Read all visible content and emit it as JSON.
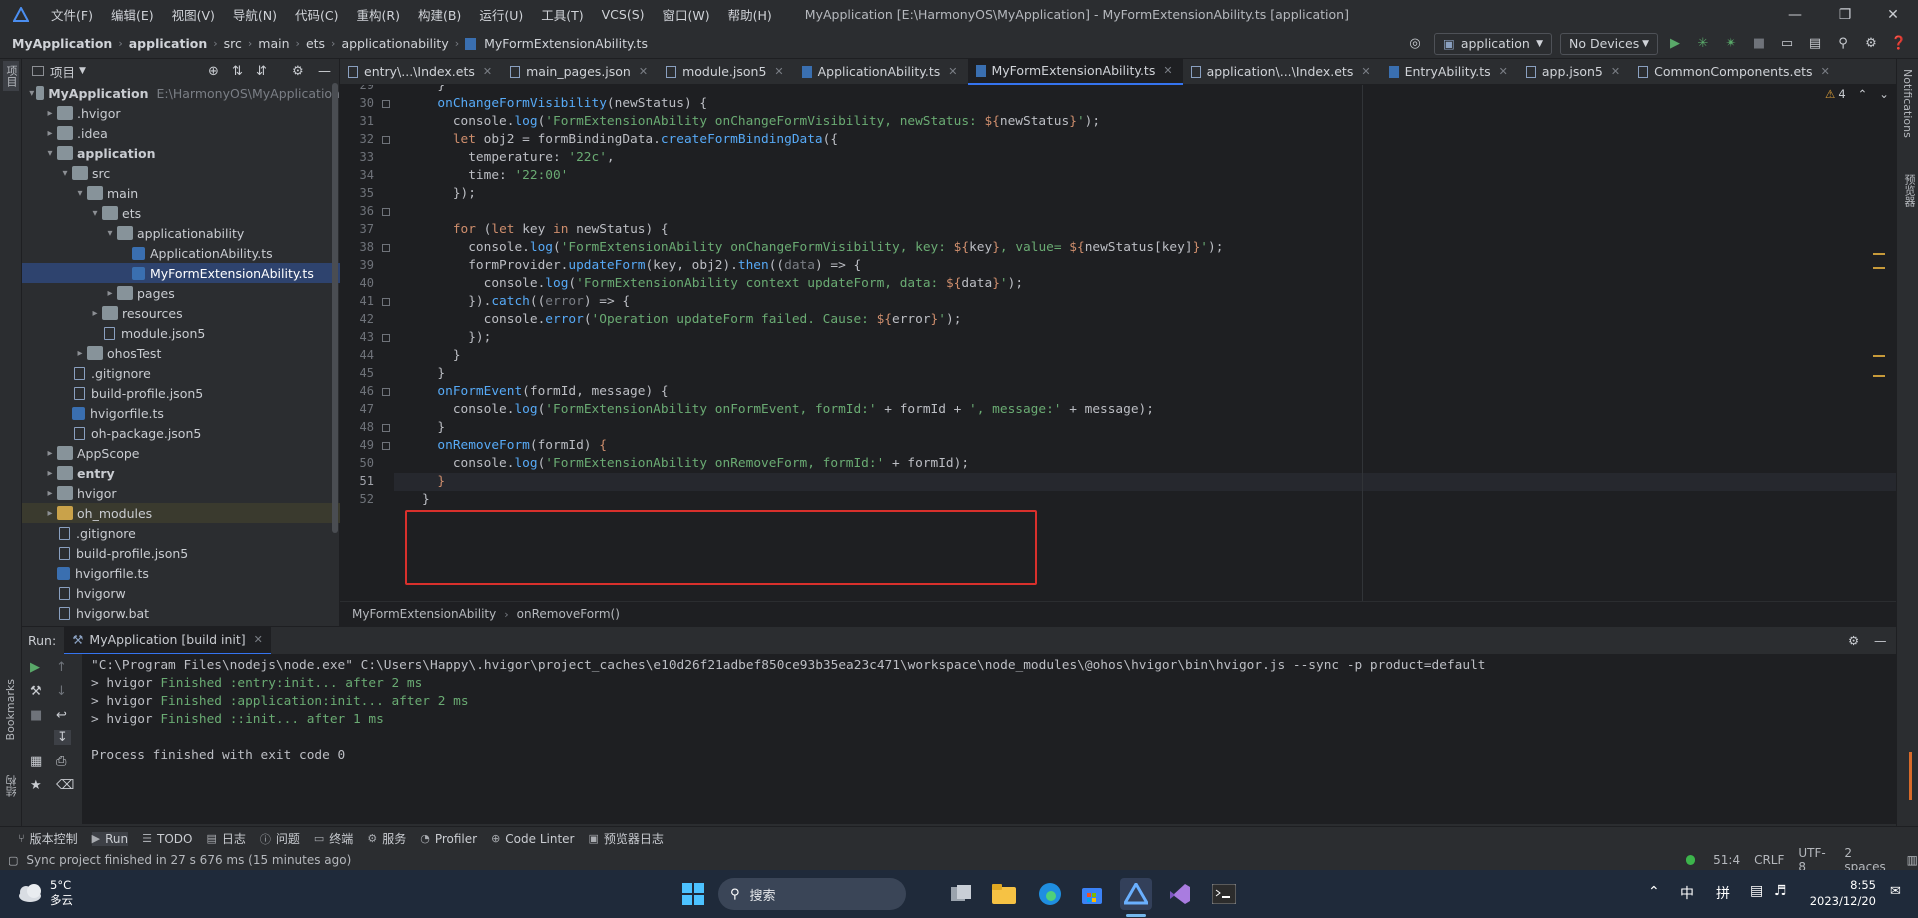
{
  "window": {
    "menus": [
      "文件(F)",
      "编辑(E)",
      "视图(V)",
      "导航(N)",
      "代码(C)",
      "重构(R)",
      "构建(B)",
      "运行(U)",
      "工具(T)",
      "VCS(S)",
      "窗口(W)",
      "帮助(H)"
    ],
    "title": "MyApplication [E:\\HarmonyOS\\MyApplication] - MyFormExtensionAbility.ts [application]"
  },
  "nav": {
    "breadcrumbs": [
      "MyApplication",
      "application",
      "src",
      "main",
      "ets",
      "applicationability",
      "MyFormExtensionAbility.ts"
    ],
    "run_config": "application",
    "device": "No Devices"
  },
  "sidebar": {
    "left_label": "项目",
    "bookmarks": "Bookmarks",
    "structure": "结构",
    "notifications": "Notifications",
    "preview": "预览器"
  },
  "project": {
    "title": "项目",
    "tree": [
      {
        "label": "MyApplication",
        "extra": "E:\\HarmonyOS\\MyApplication",
        "depth": 0,
        "arrow": "open",
        "icon": "folder",
        "bold": true
      },
      {
        "label": ".hvigor",
        "depth": 1,
        "arrow": "closed",
        "icon": "folder"
      },
      {
        "label": ".idea",
        "depth": 1,
        "arrow": "closed",
        "icon": "folder"
      },
      {
        "label": "application",
        "depth": 1,
        "arrow": "open",
        "icon": "folder",
        "bold": true
      },
      {
        "label": "src",
        "depth": 2,
        "arrow": "open",
        "icon": "folder"
      },
      {
        "label": "main",
        "depth": 3,
        "arrow": "open",
        "icon": "folder"
      },
      {
        "label": "ets",
        "depth": 4,
        "arrow": "open",
        "icon": "folder"
      },
      {
        "label": "applicationability",
        "depth": 5,
        "arrow": "open",
        "icon": "folder"
      },
      {
        "label": "ApplicationAbility.ts",
        "depth": 6,
        "arrow": "none",
        "icon": "ts"
      },
      {
        "label": "MyFormExtensionAbility.ts",
        "depth": 6,
        "arrow": "none",
        "icon": "ts",
        "selected": true
      },
      {
        "label": "pages",
        "depth": 5,
        "arrow": "closed",
        "icon": "folder"
      },
      {
        "label": "resources",
        "depth": 4,
        "arrow": "closed",
        "icon": "folder"
      },
      {
        "label": "module.json5",
        "depth": 4,
        "arrow": "none",
        "icon": "file"
      },
      {
        "label": "ohosTest",
        "depth": 3,
        "arrow": "closed",
        "icon": "folder"
      },
      {
        "label": ".gitignore",
        "depth": 2,
        "arrow": "none",
        "icon": "file"
      },
      {
        "label": "build-profile.json5",
        "depth": 2,
        "arrow": "none",
        "icon": "file"
      },
      {
        "label": "hvigorfile.ts",
        "depth": 2,
        "arrow": "none",
        "icon": "ts"
      },
      {
        "label": "oh-package.json5",
        "depth": 2,
        "arrow": "none",
        "icon": "file"
      },
      {
        "label": "AppScope",
        "depth": 1,
        "arrow": "closed",
        "icon": "folder"
      },
      {
        "label": "entry",
        "depth": 1,
        "arrow": "closed",
        "icon": "folder",
        "bold": true
      },
      {
        "label": "hvigor",
        "depth": 1,
        "arrow": "closed",
        "icon": "folder"
      },
      {
        "label": "oh_modules",
        "depth": 1,
        "arrow": "closed",
        "icon": "folder-orange",
        "highlight": true
      },
      {
        "label": ".gitignore",
        "depth": 1,
        "arrow": "none",
        "icon": "file"
      },
      {
        "label": "build-profile.json5",
        "depth": 1,
        "arrow": "none",
        "icon": "file"
      },
      {
        "label": "hvigorfile.ts",
        "depth": 1,
        "arrow": "none",
        "icon": "ts"
      },
      {
        "label": "hvigorw",
        "depth": 1,
        "arrow": "none",
        "icon": "file"
      },
      {
        "label": "hvigorw.bat",
        "depth": 1,
        "arrow": "none",
        "icon": "file"
      }
    ]
  },
  "tabs": [
    {
      "label": "entry\\...\\Index.ets"
    },
    {
      "label": "main_pages.json"
    },
    {
      "label": "module.json5"
    },
    {
      "label": "ApplicationAbility.ts"
    },
    {
      "label": "MyFormExtensionAbility.ts",
      "active": true
    },
    {
      "label": "application\\...\\Index.ets"
    },
    {
      "label": "EntryAbility.ts"
    },
    {
      "label": "app.json5"
    },
    {
      "label": "CommonComponents.ets"
    }
  ],
  "editor": {
    "warnings": "4",
    "lines": [
      {
        "n": "29",
        "t": [
          [
            "vr",
            "  }"
          ]
        ]
      },
      {
        "n": "30",
        "t": [
          [
            "fn",
            "  onChangeFormVisibility"
          ],
          [
            "vr",
            "(newStatus) {"
          ]
        ]
      },
      {
        "n": "31",
        "t": [
          [
            "vr",
            "    console."
          ],
          [
            "fn",
            "log"
          ],
          [
            "vr",
            "("
          ],
          [
            "st",
            "'FormExtensionAbility onChangeFormVisibility, newStatus: "
          ],
          [
            "kw",
            "${"
          ],
          [
            "vr",
            "newStatus"
          ],
          [
            "kw",
            "}"
          ],
          [
            "st",
            "'"
          ],
          [
            "vr",
            ");"
          ]
        ]
      },
      {
        "n": "32",
        "t": [
          [
            "kw",
            "    let "
          ],
          [
            "vr",
            "obj2 = formBindingData."
          ],
          [
            "fn",
            "createFormBindingData"
          ],
          [
            "vr",
            "({"
          ]
        ]
      },
      {
        "n": "33",
        "t": [
          [
            "vr",
            "      temperature: "
          ],
          [
            "st",
            "'22c'"
          ],
          [
            "vr",
            ","
          ]
        ]
      },
      {
        "n": "34",
        "t": [
          [
            "vr",
            "      time: "
          ],
          [
            "st",
            "'22:00'"
          ]
        ]
      },
      {
        "n": "35",
        "t": [
          [
            "vr",
            "    });"
          ]
        ]
      },
      {
        "n": "36",
        "t": [
          [
            "vr",
            ""
          ]
        ]
      },
      {
        "n": "37",
        "t": [
          [
            "kw",
            "    for "
          ],
          [
            "vr",
            "("
          ],
          [
            "kw",
            "let "
          ],
          [
            "vr",
            "key "
          ],
          [
            "kw",
            "in "
          ],
          [
            "vr",
            "newStatus) {"
          ]
        ]
      },
      {
        "n": "38",
        "t": [
          [
            "vr",
            "      console."
          ],
          [
            "fn",
            "log"
          ],
          [
            "vr",
            "("
          ],
          [
            "st",
            "'FormExtensionAbility onChangeFormVisibility, key: "
          ],
          [
            "kw",
            "${"
          ],
          [
            "vr",
            "key"
          ],
          [
            "kw",
            "}"
          ],
          [
            "st",
            ", value= "
          ],
          [
            "kw",
            "${"
          ],
          [
            "vr",
            "newStatus[key]"
          ],
          [
            "kw",
            "}"
          ],
          [
            "st",
            "'"
          ],
          [
            "vr",
            ");"
          ]
        ]
      },
      {
        "n": "39",
        "t": [
          [
            "vr",
            "      formProvider."
          ],
          [
            "fn",
            "updateForm"
          ],
          [
            "vr",
            "(key, obj2)."
          ],
          [
            "fn",
            "then"
          ],
          [
            "vr",
            "(("
          ],
          [
            "gy",
            "data"
          ],
          [
            "vr",
            ") => {"
          ]
        ]
      },
      {
        "n": "40",
        "t": [
          [
            "vr",
            "        console."
          ],
          [
            "fn",
            "log"
          ],
          [
            "vr",
            "("
          ],
          [
            "st",
            "'FormExtensionAbility context updateForm, data: "
          ],
          [
            "kw",
            "${"
          ],
          [
            "vr",
            "data"
          ],
          [
            "kw",
            "}"
          ],
          [
            "st",
            "'"
          ],
          [
            "vr",
            ");"
          ]
        ]
      },
      {
        "n": "41",
        "t": [
          [
            "vr",
            "      })."
          ],
          [
            "fn",
            "catch"
          ],
          [
            "vr",
            "(("
          ],
          [
            "gy",
            "error"
          ],
          [
            "vr",
            ") => {"
          ]
        ]
      },
      {
        "n": "42",
        "t": [
          [
            "vr",
            "        console."
          ],
          [
            "fn",
            "error"
          ],
          [
            "vr",
            "("
          ],
          [
            "st",
            "'Operation updateForm failed. Cause: "
          ],
          [
            "kw",
            "${"
          ],
          [
            "vr",
            "error"
          ],
          [
            "kw",
            "}"
          ],
          [
            "st",
            "'"
          ],
          [
            "vr",
            ");"
          ]
        ]
      },
      {
        "n": "43",
        "t": [
          [
            "vr",
            "      });"
          ]
        ]
      },
      {
        "n": "44",
        "t": [
          [
            "vr",
            "    }"
          ]
        ]
      },
      {
        "n": "45",
        "t": [
          [
            "vr",
            "  }"
          ]
        ]
      },
      {
        "n": "46",
        "t": [
          [
            "fn",
            "  onFormEvent"
          ],
          [
            "vr",
            "(formId, message) {"
          ]
        ]
      },
      {
        "n": "47",
        "t": [
          [
            "vr",
            "    console."
          ],
          [
            "fn",
            "log"
          ],
          [
            "vr",
            "("
          ],
          [
            "st",
            "'FormExtensionAbility onFormEvent, formId:'"
          ],
          [
            "vr",
            " + formId + "
          ],
          [
            "st",
            "', message:'"
          ],
          [
            "vr",
            " + message);"
          ]
        ]
      },
      {
        "n": "48",
        "t": [
          [
            "vr",
            "  }"
          ]
        ]
      },
      {
        "n": "49",
        "t": [
          [
            "fn",
            "  onRemoveForm"
          ],
          [
            "vr",
            "(formId) "
          ],
          [
            "kw",
            "{"
          ]
        ]
      },
      {
        "n": "50",
        "t": [
          [
            "vr",
            "    console."
          ],
          [
            "fn",
            "log"
          ],
          [
            "vr",
            "("
          ],
          [
            "st",
            "'FormExtensionAbility onRemoveForm, formId:'"
          ],
          [
            "vr",
            " + formId);"
          ]
        ]
      },
      {
        "n": "51",
        "t": [
          [
            "kw",
            "  }"
          ]
        ],
        "current": true
      },
      {
        "n": "52",
        "t": [
          [
            "vr",
            "}"
          ]
        ]
      }
    ],
    "breadcrumb": [
      "MyFormExtensionAbility",
      "onRemoveForm()"
    ]
  },
  "run": {
    "label": "Run:",
    "tab": "MyApplication [build init]",
    "lines": [
      {
        "cmd": "\"C:\\Program Files\\nodejs\\node.exe\" C:\\Users\\Happy\\.hvigor\\project_caches\\e10d26f21adbef850ce93b35ea23c471\\workspace\\node_modules\\@ohos\\hvigor\\bin\\hvigor.js --sync -p product=default"
      },
      {
        "pre": "> hvigor ",
        "ok": "Finished ",
        "rest": ":entry:init... after 2 ms"
      },
      {
        "pre": "> hvigor ",
        "ok": "Finished ",
        "rest": ":application:init... after 2 ms"
      },
      {
        "pre": "> hvigor ",
        "ok": "Finished ",
        "rest": "::init... after 1 ms"
      },
      {
        "cmd": ""
      },
      {
        "cmd": "Process finished with exit code 0"
      }
    ]
  },
  "tools": [
    "版本控制",
    "Run",
    "TODO",
    "日志",
    "问题",
    "终端",
    "服务",
    "Profiler",
    "Code Linter",
    "预览器日志"
  ],
  "status": {
    "message": "Sync project finished in 27 s 676 ms (15 minutes ago)",
    "position": "51:4",
    "line_sep": "CRLF",
    "encoding": "UTF-8",
    "indent": "2 spaces"
  },
  "taskbar": {
    "temp": "5°C",
    "weather": "多云",
    "search": "搜索",
    "ime1": "中",
    "ime2": "拼",
    "time": "8:55",
    "date": "2023/12/20"
  }
}
